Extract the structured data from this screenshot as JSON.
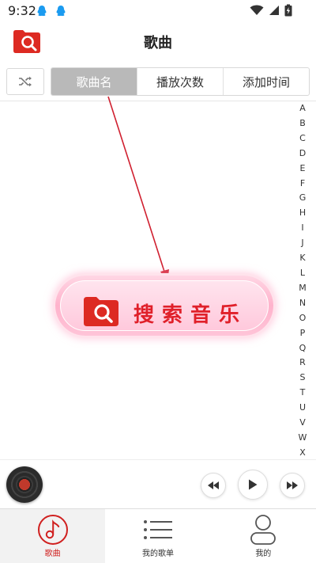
{
  "status_bar": {
    "time": "9:32"
  },
  "header": {
    "title": "歌曲",
    "logo_icon": "folder-search-icon"
  },
  "sort_tabs": [
    {
      "label": "歌曲名",
      "active": true
    },
    {
      "label": "播放次数",
      "active": false
    },
    {
      "label": "添加时间",
      "active": false
    }
  ],
  "alphabet": [
    "A",
    "B",
    "C",
    "D",
    "E",
    "F",
    "G",
    "H",
    "I",
    "J",
    "K",
    "L",
    "M",
    "N",
    "O",
    "P",
    "Q",
    "R",
    "S",
    "T",
    "U",
    "V",
    "W",
    "X"
  ],
  "search_button": {
    "label": "搜索音乐"
  },
  "bottom_nav": [
    {
      "label": "歌曲",
      "icon": "music-note-icon",
      "active": true
    },
    {
      "label": "我的歌单",
      "icon": "playlist-icon",
      "active": false
    },
    {
      "label": "我的",
      "icon": "person-icon",
      "active": false
    }
  ],
  "colors": {
    "accent_red": "#d0201f",
    "active_tab": "#b9b9b9"
  }
}
